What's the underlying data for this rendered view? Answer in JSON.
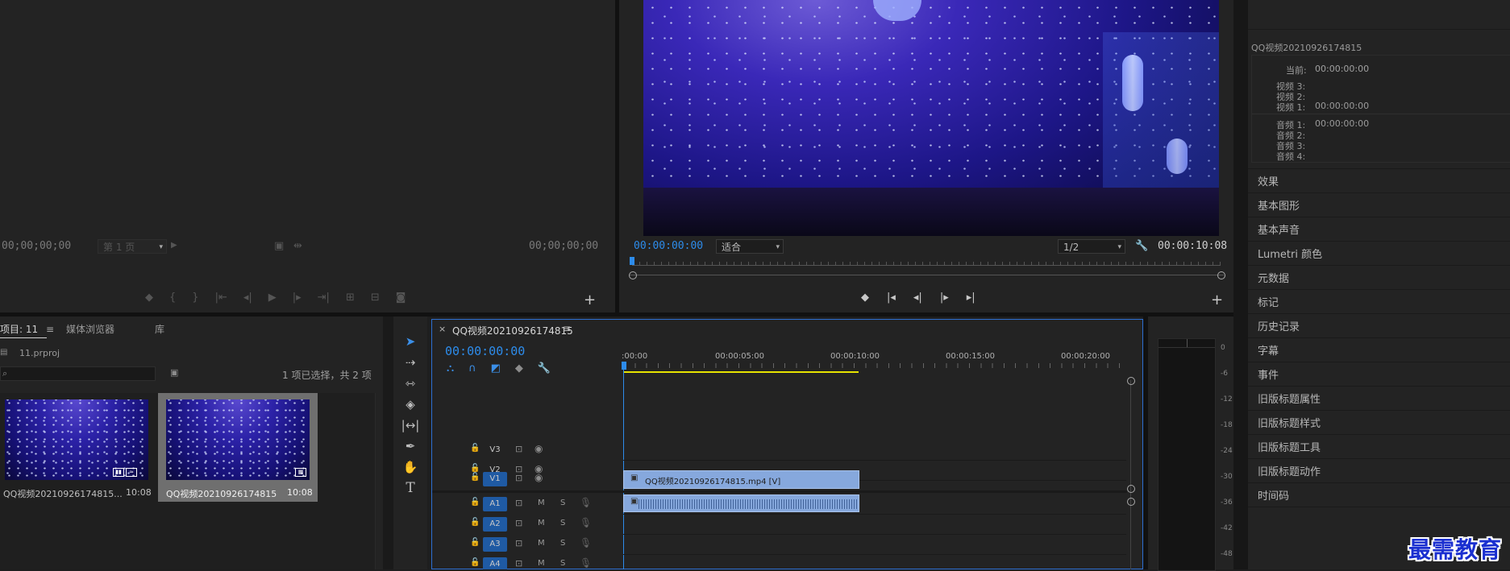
{
  "source_monitor": {
    "timecode_in": "00;00;00;00",
    "timecode_out": "00;00;00;00",
    "page_select": "第 1 页"
  },
  "program_monitor": {
    "timecode_current": "00:00:00:00",
    "fit_select": "适合",
    "resolution_select": "1/2",
    "timecode_duration": "00:00:10:08"
  },
  "info_panel": {
    "title": "QQ视频20210926174815",
    "rows": [
      {
        "label": "当前:",
        "value": "00:00:00:00"
      },
      {
        "label": "视频 3:",
        "value": ""
      },
      {
        "label": "视频 2:",
        "value": ""
      },
      {
        "label": "视频 1:",
        "value": "00:00:00:00"
      },
      {
        "label": "音频 1:",
        "value": "00:00:00:00"
      },
      {
        "label": "音频 2:",
        "value": ""
      },
      {
        "label": "音频 3:",
        "value": ""
      },
      {
        "label": "音频 4:",
        "value": ""
      }
    ]
  },
  "right_panels": [
    "效果",
    "基本图形",
    "基本声音",
    "Lumetri 颜色",
    "元数据",
    "标记",
    "历史记录",
    "字幕",
    "事件",
    "旧版标题属性",
    "旧版标题样式",
    "旧版标题工具",
    "旧版标题动作",
    "时间码"
  ],
  "project_panel": {
    "tabs": [
      "项目: 11",
      "媒体浏览器",
      "库"
    ],
    "file_name": "11.prproj",
    "selection_status": "1 项已选择，共 2 项",
    "items": [
      {
        "name": "QQ视频20210926174815...",
        "duration": "10:08"
      },
      {
        "name": "QQ视频20210926174815",
        "duration": "10:08"
      }
    ]
  },
  "timeline": {
    "tab_label": "QQ视频20210926174815",
    "timecode": "00:00:00:00",
    "ruler_labels": [
      ":00:00",
      "00:00:05:00",
      "00:00:10:00",
      "00:00:15:00",
      "00:00:20:00"
    ],
    "tracks": [
      {
        "name": "V3",
        "type": "video"
      },
      {
        "name": "V2",
        "type": "video"
      },
      {
        "name": "V1",
        "type": "video"
      },
      {
        "name": "A1",
        "type": "audio"
      },
      {
        "name": "A2",
        "type": "audio"
      },
      {
        "name": "A3",
        "type": "audio"
      },
      {
        "name": "A4",
        "type": "audio"
      }
    ],
    "mute_label": "M",
    "solo_label": "S",
    "video_clip_label": "QQ视频20210926174815.mp4 [V]"
  },
  "audio_meter": {
    "scale": [
      "0",
      "-6",
      "-12",
      "-18",
      "-24",
      "-30",
      "-36",
      "-42",
      "-48"
    ]
  },
  "watermark": "最需教育",
  "colors": {
    "accent_blue": "#2d8ceb",
    "clip_blue": "#86a8dd",
    "work_area": "#e6e300"
  }
}
